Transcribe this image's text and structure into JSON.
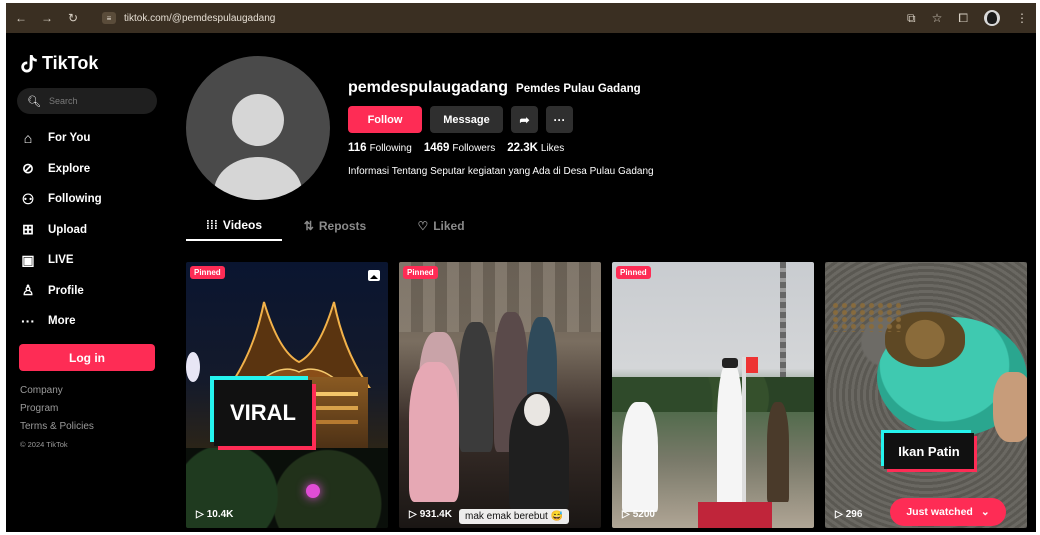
{
  "browser": {
    "url": "tiktok.com/@pemdespulaugadang"
  },
  "sidebar": {
    "logo_text": "TikTok",
    "search_placeholder": "Search",
    "items": [
      {
        "label": "For You",
        "icon": "home-icon"
      },
      {
        "label": "Explore",
        "icon": "compass-icon"
      },
      {
        "label": "Following",
        "icon": "following-icon"
      },
      {
        "label": "Upload",
        "icon": "upload-icon"
      },
      {
        "label": "LIVE",
        "icon": "live-icon"
      },
      {
        "label": "Profile",
        "icon": "profile-icon"
      },
      {
        "label": "More",
        "icon": "more-icon"
      }
    ],
    "login_label": "Log in",
    "footer": [
      "Company",
      "Program",
      "Terms & Policies"
    ],
    "copyright": "© 2024 TikTok"
  },
  "profile": {
    "username": "pemdespulaugadang",
    "nickname": "Pemdes Pulau Gadang",
    "follow_label": "Follow",
    "message_label": "Message",
    "following_count": "116",
    "following_label": "Following",
    "followers_count": "1469",
    "followers_label": "Followers",
    "likes_count": "22.3K",
    "likes_label": "Likes",
    "bio": "Informasi Tentang Seputar kegiatan yang Ada di Desa Pulau Gadang"
  },
  "tabs": [
    {
      "label": "Videos",
      "active": true
    },
    {
      "label": "Reposts",
      "active": false
    },
    {
      "label": "Liked",
      "active": false
    }
  ],
  "videos": [
    {
      "pinned_label": "Pinned",
      "views": "10.4K",
      "overlay_text": "VIRAL"
    },
    {
      "pinned_label": "Pinned",
      "views": "931.4K",
      "caption": "mak emak berebut 😅"
    },
    {
      "pinned_label": "Pinned",
      "views": "5200"
    },
    {
      "views": "296",
      "overlay_text": "Ikan Patin",
      "just_watched_label": "Just watched"
    }
  ],
  "colors": {
    "accent": "#fe2c55",
    "cyan": "#25f4ee",
    "background": "#000000"
  }
}
